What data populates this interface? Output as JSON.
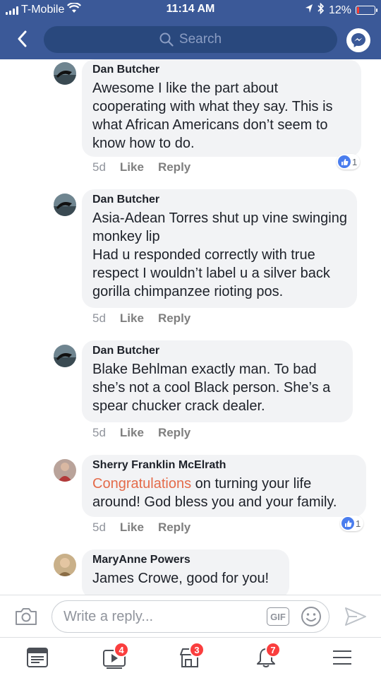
{
  "status_bar": {
    "carrier": "T-Mobile",
    "time": "11:14 AM",
    "battery": "12%",
    "battery_level": 0.12,
    "icons": [
      "signal-icon",
      "wifi-icon",
      "location-arrow-icon",
      "bluetooth-icon",
      "battery-icon"
    ]
  },
  "header": {
    "search_placeholder": "Search",
    "icons": [
      "back-chevron-icon",
      "search-icon",
      "messenger-icon"
    ]
  },
  "comments": [
    {
      "author": "Dan Butcher",
      "text": "Awesome I like the part about cooperating with what they say. This is what African Americans don’t seem to know how to do.",
      "time": "5d",
      "like_label": "Like",
      "reply_label": "Reply",
      "reaction_count": "1"
    },
    {
      "author": "Dan Butcher",
      "text": "Asia-Adean Torres shut up vine swinging monkey lip\nHad u responded correctly with true respect I wouldn’t label u a silver back gorilla chimpanzee rioting pos.",
      "time": "5d",
      "like_label": "Like",
      "reply_label": "Reply"
    },
    {
      "author": "Dan Butcher",
      "text": "Blake Behlman exactly man. To bad she’s not a cool Black person. She’s a spear chucker crack dealer.",
      "time": "5d",
      "like_label": "Like",
      "reply_label": "Reply"
    },
    {
      "author": "Sherry Franklin McElrath",
      "highlight": "Congratulations",
      "text": " on turning your life around!  God bless you and your family.",
      "time": "5d",
      "like_label": "Like",
      "reply_label": "Reply",
      "reaction_count": "1"
    },
    {
      "author": "MaryAnne Powers",
      "text": "James Crowe, good for you!"
    }
  ],
  "reply_bar": {
    "placeholder": "Write a reply...",
    "gif_label": "GIF",
    "icons": [
      "camera-icon",
      "gif-icon",
      "emoji-icon",
      "send-icon"
    ]
  },
  "tab_bar": {
    "badges": {
      "video": "4",
      "marketplace": "3",
      "notifications": "7"
    },
    "icons": [
      "news-feed-icon",
      "video-icon",
      "marketplace-icon",
      "bell-icon",
      "menu-icon"
    ]
  },
  "colors": {
    "header_bg": "#3b5998",
    "search_bg": "#29487d",
    "bubble_bg": "#f2f3f5",
    "highlight": "#e46b4a",
    "like_blue": "#4a7dee",
    "badge_red": "#fa3e3e"
  }
}
